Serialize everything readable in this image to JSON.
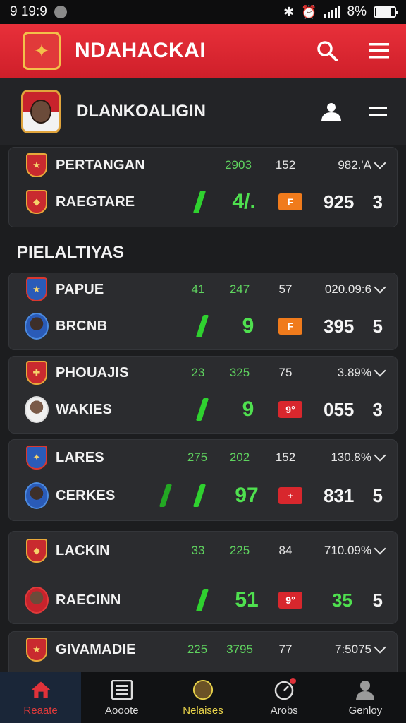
{
  "status": {
    "time": "9 19:9",
    "battery": "8%"
  },
  "app": {
    "title": "NDAHACKAI"
  },
  "team": {
    "name": "DLANKOALIGIN"
  },
  "featured": {
    "top": {
      "name": "PERTANGAN",
      "a": "2903",
      "b": "152",
      "pct": "982.'A"
    },
    "bottom": {
      "name": "RAEGTARE",
      "score": "4/.",
      "tag": "F",
      "total": "925",
      "rank": "3"
    }
  },
  "section": {
    "title": "PIELALTIYAS"
  },
  "cards": [
    {
      "top": {
        "name": "PAPUE",
        "a": "41",
        "b": "247",
        "c": "57",
        "pct": "020.09:6"
      },
      "bottom": {
        "name": "BRCNB",
        "score": "9",
        "tag": "F",
        "tag_color": "orange",
        "total": "395",
        "rank": "5"
      }
    },
    {
      "top": {
        "name": "PHOUAJIS",
        "a": "23",
        "b": "325",
        "c": "75",
        "pct": "3.89%"
      },
      "bottom": {
        "name": "WAKIES",
        "score": "9",
        "tag": "9°",
        "tag_color": "red",
        "total": "055",
        "rank": "3"
      }
    },
    {
      "top": {
        "name": "LARES",
        "a": "275",
        "b": "202",
        "c": "152",
        "pct": "130.8%"
      },
      "bottom": {
        "name": "CERKES",
        "score": "97",
        "tag": "+",
        "tag_color": "red",
        "total": "831",
        "rank": "5"
      }
    },
    {
      "top": {
        "name": "LACKIN",
        "a": "33",
        "b": "225",
        "c": "84",
        "pct": "710.09%"
      },
      "bottom": {
        "name": "RAECINN",
        "score": "51",
        "tag": "9°",
        "tag_color": "red",
        "total": "35",
        "rank": "5"
      }
    },
    {
      "top": {
        "name": "GIVAMADIE",
        "a": "225",
        "b": "3795",
        "c": "77",
        "pct": "7:5075"
      }
    }
  ],
  "nav": [
    {
      "label": "Reaate",
      "icon": "home-icon"
    },
    {
      "label": "Aooote",
      "icon": "scoreboard-icon"
    },
    {
      "label": "Nelaises",
      "icon": "ball-icon"
    },
    {
      "label": "Arobs",
      "icon": "timer-icon"
    },
    {
      "label": "Genloy",
      "icon": "profile-icon"
    }
  ],
  "colors": {
    "accent": "#e0303a",
    "score_green": "#4fe04f",
    "bg": "#1c1d1f"
  }
}
